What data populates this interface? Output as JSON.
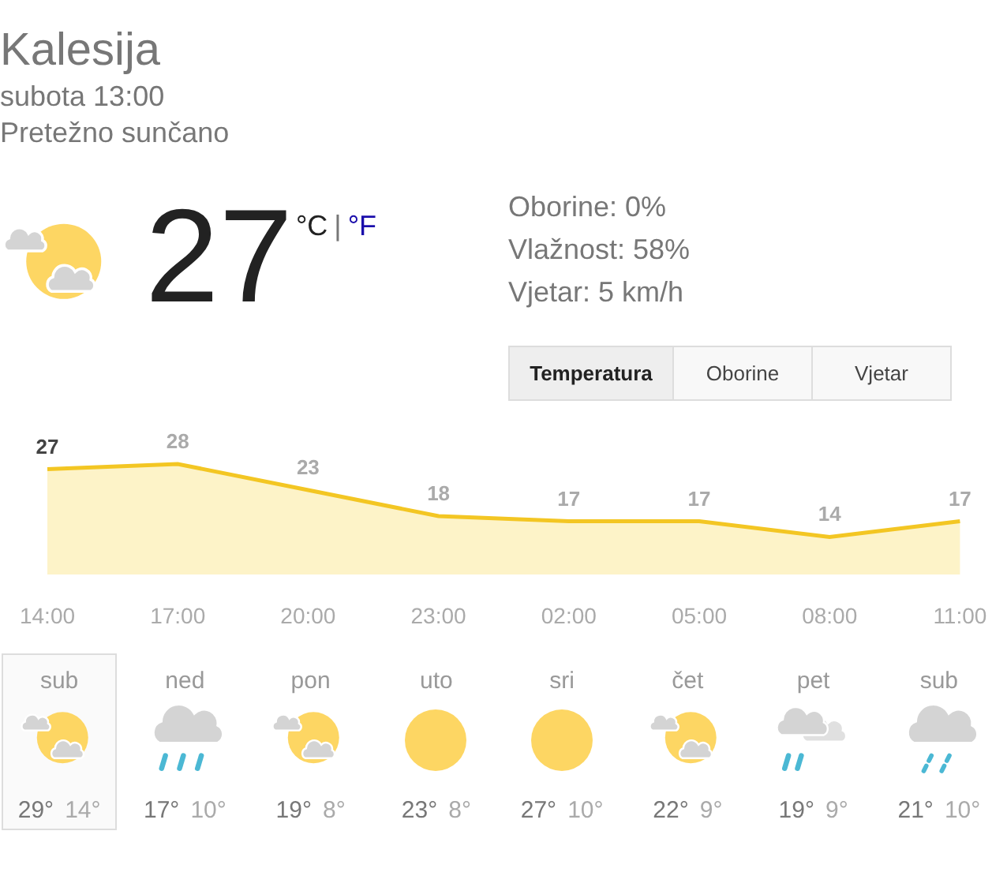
{
  "location": "Kalesija",
  "datetime": "subota 13:00",
  "condition": "Pretežno sunčano",
  "current": {
    "kind": "partly-cloudy",
    "temperature": "27",
    "unit_c": "°C",
    "separator": "|",
    "unit_f": "°F"
  },
  "details": [
    "Oborine: 0%",
    "Vlažnost: 58%",
    "Vjetar: 5 km/h"
  ],
  "tabs": [
    {
      "label": "Temperatura",
      "selected": true
    },
    {
      "label": "Oborine",
      "selected": false
    },
    {
      "label": "Vjetar",
      "selected": false
    }
  ],
  "chart": {
    "chart_data": {
      "type": "area",
      "categories": [
        "14:00",
        "17:00",
        "20:00",
        "23:00",
        "02:00",
        "05:00",
        "08:00",
        "11:00"
      ],
      "series": [
        {
          "color": "#f3c623",
          "values": [
            27,
            28,
            23,
            18,
            17,
            17,
            14,
            17
          ]
        }
      ],
      "data_labels": true
    }
  },
  "days": [
    {
      "day": "sub",
      "kind": "partly-cloudy",
      "high": "29°",
      "low": "14°",
      "selected": true
    },
    {
      "day": "ned",
      "kind": "rain",
      "high": "17°",
      "low": "10°",
      "selected": false
    },
    {
      "day": "pon",
      "kind": "partly-cloudy",
      "high": "19°",
      "low": "8°",
      "selected": false
    },
    {
      "day": "uto",
      "kind": "sunny",
      "high": "23°",
      "low": "8°",
      "selected": false
    },
    {
      "day": "sri",
      "kind": "sunny",
      "high": "27°",
      "low": "10°",
      "selected": false
    },
    {
      "day": "čet",
      "kind": "partly-cloudy",
      "high": "22°",
      "low": "9°",
      "selected": false
    },
    {
      "day": "pet",
      "kind": "showers",
      "high": "19°",
      "low": "9°",
      "selected": false
    },
    {
      "day": "sub",
      "kind": "drizzle",
      "high": "21°",
      "low": "10°",
      "selected": false
    }
  ]
}
